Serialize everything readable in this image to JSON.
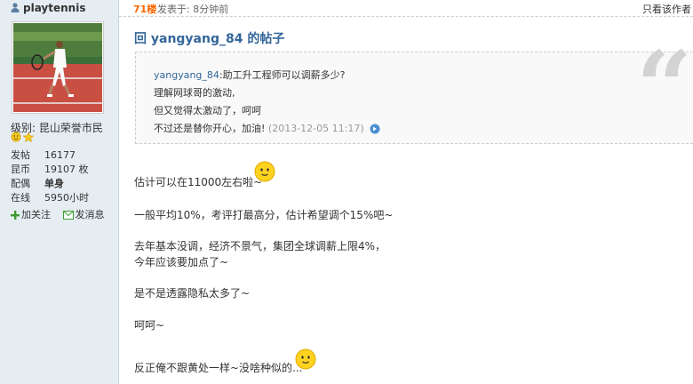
{
  "user": {
    "username": "playtennis",
    "level_label": "级别:",
    "level_value": "昆山荣誉市民",
    "stats": [
      {
        "key": "发帖",
        "value": "16177",
        "bold": false
      },
      {
        "key": "昆币",
        "value": "19107 枚",
        "bold": false
      },
      {
        "key": "配偶",
        "value": "单身",
        "bold": true
      },
      {
        "key": "在线",
        "value": "5950小时",
        "bold": false
      }
    ],
    "follow_label": "加关注",
    "message_label": "发消息"
  },
  "post": {
    "floor": "71楼",
    "posted_at": "发表于: 8分钟前",
    "only_author": "只看该作者",
    "reply_title": "回  yangyang_84 的帖子",
    "quote": {
      "author": "yangyang_84",
      "question": ":助工升工程师可以调薪多少?",
      "lines": [
        "理解网球哥的激动,",
        "但又觉得太激动了，呵呵"
      ],
      "last_line": "不过还是替你开心，加油!",
      "time": "(2013-12-05 11:17)"
    },
    "body": [
      "估计可以在11000左右啦~",
      "一般平均10%，考评打最高分，估计希望调个15%吧~",
      "去年基本没调，经济不景气，集团全球调薪上限4%，",
      "今年应该要加点了~",
      "是不是透露隐私太多了~",
      "呵呵~",
      "反正俺不跟黄处一样~没啥种似的..."
    ]
  },
  "colors": {
    "floor": "#ff6600",
    "link": "#336699",
    "sidebar": "#e5edf2"
  }
}
